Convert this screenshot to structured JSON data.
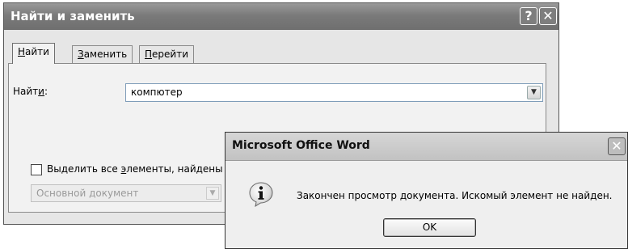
{
  "find_dialog": {
    "title": "Найти и заменить",
    "help_button": "?",
    "close_button": "✕",
    "tabs": [
      {
        "pre": "",
        "key": "Н",
        "post": "айти"
      },
      {
        "pre": "",
        "key": "З",
        "post": "аменить"
      },
      {
        "pre": "",
        "key": "П",
        "post": "ерейти"
      }
    ],
    "find_label": {
      "pre": "Найт",
      "key": "и",
      "post": ":"
    },
    "find_value": "компютер",
    "highlight_checkbox": {
      "pre": "Выделить все ",
      "key": "э",
      "post": "лементы, найдены"
    },
    "scope_value": "Основной документ"
  },
  "message_box": {
    "title": "Microsoft Office Word",
    "close_button": "✕",
    "text": "Закончен просмотр документа. Искомый элемент не найден.",
    "ok_label": "OK"
  }
}
